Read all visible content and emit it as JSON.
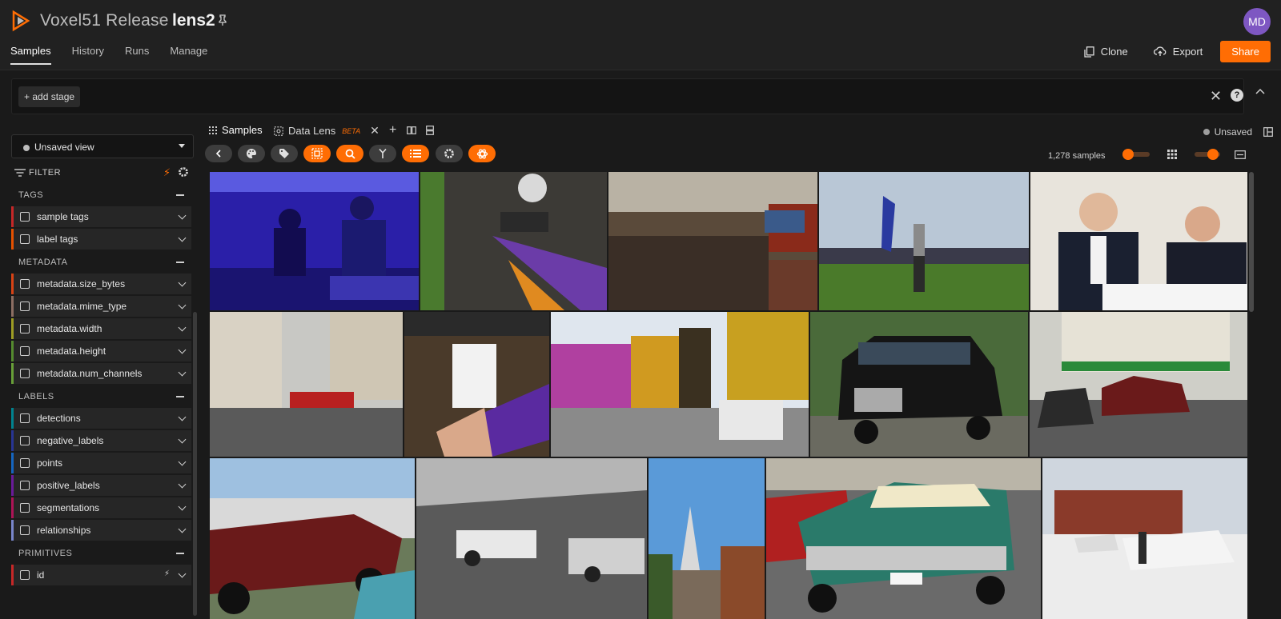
{
  "header": {
    "brand": "Voxel51 Release",
    "crumb_sep": "›",
    "dataset": "lens2",
    "avatar_initials": "MD",
    "tabs": [
      {
        "label": "Samples",
        "active": true
      },
      {
        "label": "History",
        "active": false
      },
      {
        "label": "Runs",
        "active": false
      },
      {
        "label": "Manage",
        "active": false
      }
    ],
    "clone_label": "Clone",
    "export_label": "Export",
    "share_label": "Share"
  },
  "stagebar": {
    "add_stage_label": "+ add stage"
  },
  "sidebar": {
    "view_label": "Unsaved view",
    "filter_label": "FILTER",
    "groups": [
      {
        "title": "TAGS",
        "fields": [
          {
            "name": "sample tags",
            "color": "#c62828"
          },
          {
            "name": "label tags",
            "color": "#e65100"
          }
        ]
      },
      {
        "title": "METADATA",
        "fields": [
          {
            "name": "metadata.size_bytes",
            "color": "#d84315"
          },
          {
            "name": "metadata.mime_type",
            "color": "#8d6e63"
          },
          {
            "name": "metadata.width",
            "color": "#9e9d24"
          },
          {
            "name": "metadata.height",
            "color": "#558b2f"
          },
          {
            "name": "metadata.num_channels",
            "color": "#689f38"
          }
        ]
      },
      {
        "title": "LABELS",
        "fields": [
          {
            "name": "detections",
            "color": "#00838f"
          },
          {
            "name": "negative_labels",
            "color": "#283593"
          },
          {
            "name": "points",
            "color": "#1565c0"
          },
          {
            "name": "positive_labels",
            "color": "#6a1b9a"
          },
          {
            "name": "segmentations",
            "color": "#ad1457"
          },
          {
            "name": "relationships",
            "color": "#7986cb"
          }
        ]
      },
      {
        "title": "PRIMITIVES",
        "fields": [
          {
            "name": "id",
            "color": "#c62828"
          }
        ]
      }
    ]
  },
  "main": {
    "tabs": [
      {
        "label": "Samples"
      },
      {
        "label": "Data Lens",
        "badge": "BETA"
      }
    ],
    "unsaved_label": "Unsaved",
    "samples_count": "1,278 samples"
  },
  "colors": {
    "accent": "#ff6d04",
    "bg": "#1a1a1a",
    "panel": "#212121"
  }
}
